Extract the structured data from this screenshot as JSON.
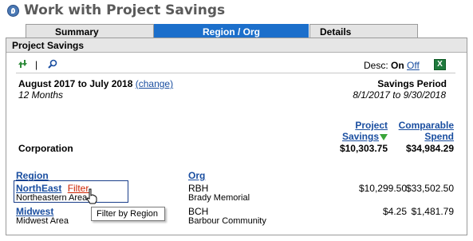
{
  "window": {
    "title": "Work with Project Savings"
  },
  "tabs": [
    {
      "label": "Summary",
      "active": false
    },
    {
      "label": "Region / Org",
      "active": true
    },
    {
      "label": "Details",
      "active": false
    }
  ],
  "panel": {
    "title": "Project Savings",
    "toolbar": {
      "refresh_icon": "refresh-arrows-icon",
      "divider": "|",
      "search_icon": "magnifier-icon",
      "desc_label": "Desc:",
      "desc_on": "On",
      "desc_off": "Off",
      "excel_icon": "excel-export-icon"
    }
  },
  "period": {
    "range": "August 2017 to July 2018",
    "change_link": "(change)",
    "months": "12 Months",
    "savings_label": "Savings Period",
    "savings_dates": "8/1/2017 to 9/30/2018"
  },
  "columns": {
    "project_savings_line1": "Project",
    "project_savings_line2": "Savings",
    "comparable_spend_line1": "Comparable",
    "comparable_spend_line2": "Spend"
  },
  "corporation": {
    "label": "Corporation",
    "project_savings": "$10,303.75",
    "comparable_spend": "$34,984.29"
  },
  "headers": {
    "region": "Region",
    "org": "Org"
  },
  "rows": [
    {
      "region": "NorthEast",
      "filter": "Filter",
      "region_desc": "Northeastern Area",
      "org": "RBH",
      "org_desc": "Brady Memorial",
      "project_savings": "$10,299.50",
      "comparable_spend": "$33,502.50"
    },
    {
      "region": "Midwest",
      "filter": "",
      "region_desc": "Midwest Area",
      "org": "BCH",
      "org_desc": "Barbour Community",
      "project_savings": "$4.25",
      "comparable_spend": "$1,481.79"
    }
  ],
  "tooltip": {
    "text": "Filter by Region"
  },
  "colors": {
    "active_tab": "#1c6fcb",
    "link": "#1a4ea0",
    "filter_link": "#cc2200",
    "sort_indicator": "#3aa53a",
    "excel": "#1f7a3d"
  }
}
